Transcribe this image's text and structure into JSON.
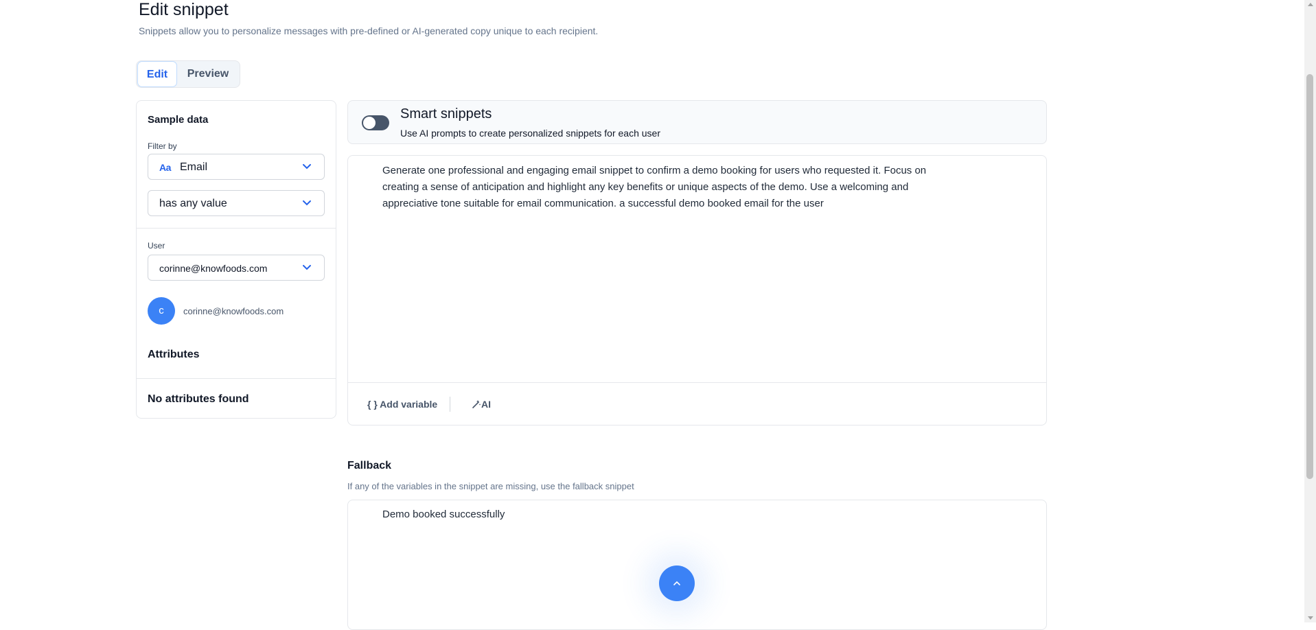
{
  "header": {
    "title": "Edit snippet",
    "subtitle": "Snippets allow you to personalize messages with pre-defined or AI-generated copy unique to each recipient."
  },
  "tabs": [
    {
      "label": "Edit",
      "active": true
    },
    {
      "label": "Preview",
      "active": false
    }
  ],
  "sample_data": {
    "title": "Sample data",
    "filter_label": "Filter by",
    "filter_field": {
      "icon": "text-type-icon",
      "icon_text": "Aa",
      "value": "Email"
    },
    "filter_condition": {
      "value": "has any value"
    },
    "user_label": "User",
    "user_select": {
      "value": "corinne@knowfoods.com"
    },
    "avatar": {
      "initial": "c",
      "email": "corinne@knowfoods.com"
    },
    "attributes_title": "Attributes",
    "no_attributes": "No attributes found"
  },
  "smart": {
    "title": "Smart snippets",
    "subtitle": "Use AI prompts to create personalized snippets for each user",
    "enabled": false
  },
  "editor": {
    "text": "Generate one professional and engaging email snippet to confirm a demo booking for users who requested it. Focus on creating a sense of anticipation and highlight any key benefits or unique aspects of the demo. Use a welcoming and appreciative tone suitable for email communication. a successful demo booked email for the user",
    "add_variable": "{ } Add variable",
    "ai_label": "AI"
  },
  "fallback": {
    "title": "Fallback",
    "subtitle": "If any of the variables in the snippet are missing, use the fallback snippet",
    "text": "Demo booked successfully"
  },
  "colors": {
    "accent": "#3b82f6",
    "accent_text": "#2563eb"
  }
}
